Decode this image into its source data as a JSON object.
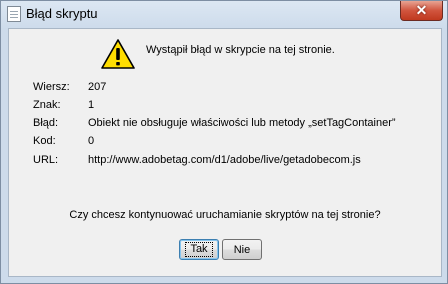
{
  "window": {
    "title": "Błąd skryptu",
    "close_glyph": "✕"
  },
  "message": {
    "icon": "warning-icon",
    "text": "Wystąpił błąd w skrypcie na tej stronie."
  },
  "details": [
    {
      "label": "Wiersz:",
      "value": "207"
    },
    {
      "label": "Znak:",
      "value": "1"
    },
    {
      "label": "Błąd:",
      "value": "Obiekt nie obsługuje właściwości lub metody „setTagContainer”"
    },
    {
      "label": "Kod:",
      "value": "0"
    },
    {
      "label": "URL:",
      "value": "http://www.adobetag.com/d1/adobe/live/getadobecom.js"
    }
  ],
  "question": "Czy chcesz kontynuować uruchamianie skryptów na tej stronie?",
  "buttons": {
    "yes_label": "Tak",
    "no_label": "Nie"
  },
  "colors": {
    "warning_fill": "#ffdd00",
    "close_button": "#c74a33",
    "default_button_border": "#3c7fb1"
  }
}
